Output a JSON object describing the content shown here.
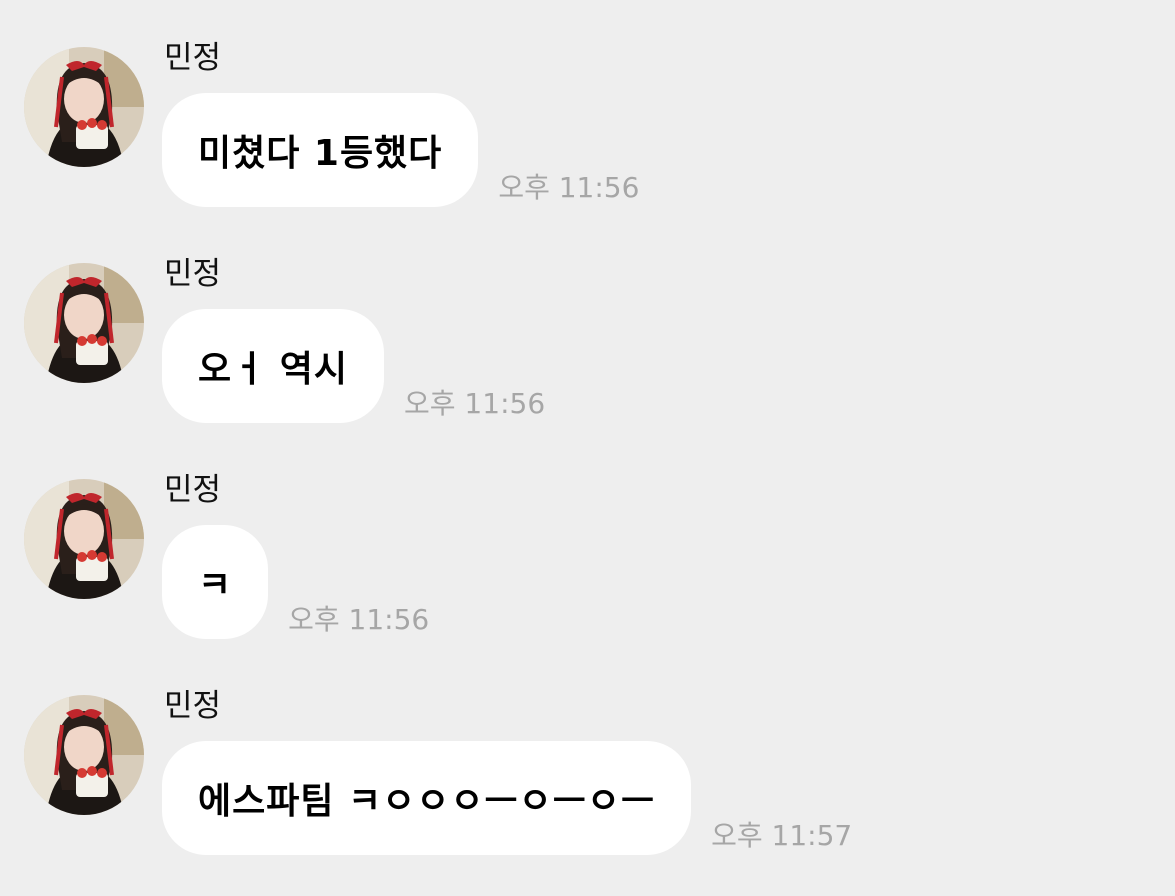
{
  "messages": [
    {
      "sender": "민정",
      "text": "미쳤다 1등했다",
      "time": "오후 11:56",
      "avatar": "profile-photo"
    },
    {
      "sender": "민정",
      "text": "오ㅓ 역시",
      "time": "오후 11:56",
      "avatar": "profile-photo"
    },
    {
      "sender": "민정",
      "text": "ㅋ",
      "time": "오후 11:56",
      "avatar": "profile-photo"
    },
    {
      "sender": "민정",
      "text": "에스파팀 ㅋㅇㅇㅇㅡㅇㅡㅇㅡ",
      "time": "오후 11:57",
      "avatar": "profile-photo"
    }
  ],
  "colors": {
    "background": "#eeeeee",
    "bubble": "#ffffff",
    "timestamp": "#a6a6a6"
  }
}
